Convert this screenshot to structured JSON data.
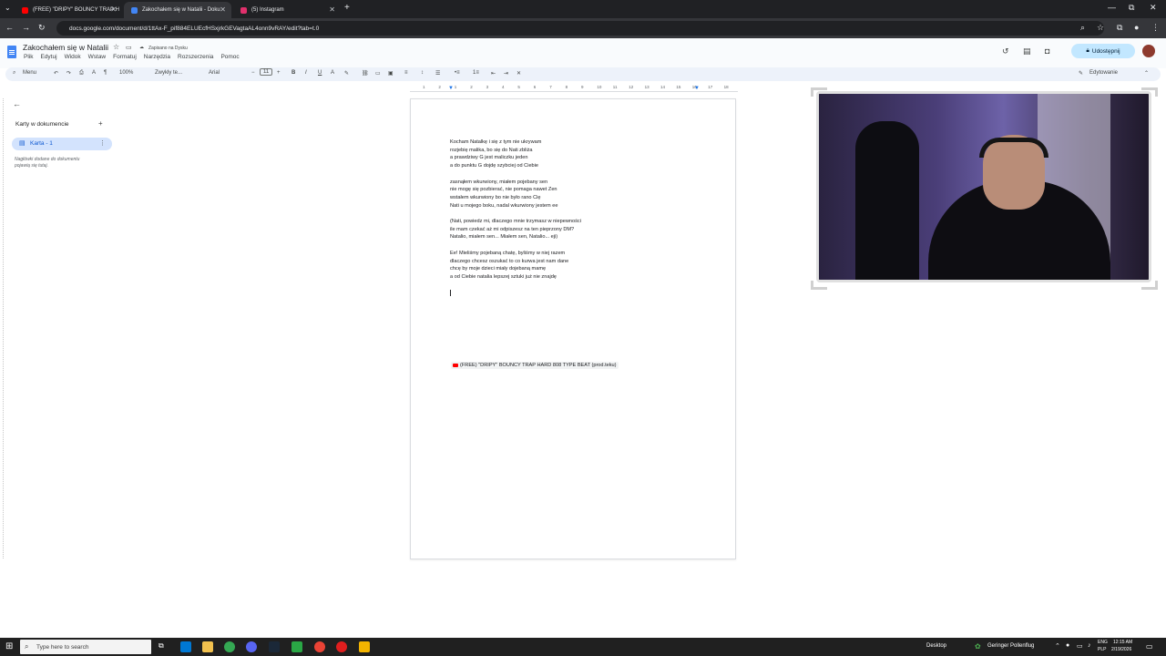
{
  "browser": {
    "tabs": [
      {
        "label": "(FREE) \"DRIPY\" BOUNCY TRAP H",
        "color": "#ff0000",
        "active": false
      },
      {
        "label": "Zakochałem się w Natalii - Doku",
        "color": "#4285f4",
        "active": true
      },
      {
        "label": "(5) Instagram",
        "color": "#e1306c",
        "active": false
      }
    ],
    "url": "docs.google.com/document/d/1ttAx-F_pif884ELUEcfHSxjrkGEVagtaAL4onn9vRAY/edit?tab=t.0",
    "window_controls": [
      "—",
      "⧉",
      "✕"
    ]
  },
  "docs": {
    "title": "Zakochałem się w Natalii",
    "saved_status": "Zapisano na Dysku",
    "menu": [
      "Plik",
      "Edytuj",
      "Widok",
      "Wstaw",
      "Formatuj",
      "Narzędzia",
      "Rozszerzenia",
      "Pomoc"
    ],
    "share_label": "Udostępnij",
    "mode_label": "Edytowanie",
    "toolbar": {
      "menu_label": "Menu",
      "zoom": "100%",
      "style": "Zwykły te...",
      "font": "Arial",
      "font_size": "11"
    },
    "ruler_ticks": [
      "1",
      "2",
      "1",
      "2",
      "3",
      "4",
      "5",
      "6",
      "7",
      "8",
      "9",
      "10",
      "11",
      "12",
      "13",
      "14",
      "15",
      "16",
      "17",
      "18"
    ],
    "sidebar": {
      "title": "Karty w dokumencie",
      "tab_label": "Karta - 1",
      "hint_line1": "Nagłówki dodane do dokumentu",
      "hint_line2": "pojawią się tutaj."
    },
    "lines": [
      "Kocham Natalkę i się z tym nie ukrywam",
      "rozjebię malika, bo się do Nati zbliża",
      "a prawdziwy G jest maliczku jeden",
      "a do punktu G dojdę szybciej od Ciebie",
      "",
      "zasnąłem wkurwiony, miałem pojebany sen",
      "nie mogę się pozbierać, nie pomaga nawet Zen",
      "wstałem wkurwiony bo nie było rano Cię",
      "Nati u mojego boku, nadal wkurwiony jestem ee",
      "",
      "(Nati, powiedz mi, dlaczego mnie trzymasz w niepewności",
      "ile mam czekać aż mi odpiszesz na ten pieprzony DM?",
      "Natalio, miałem sen... Miałem sen, Natalio... eji)",
      "",
      "Ee! Mieliśmy pojebaną chatę, byliśmy w niej razem",
      "dlaczego chcesz oszukać to co kurwa jest nam dane",
      "chcę by moje dzieci miały dojebaną mamę",
      "a od Ciebie natalia lepszej sztuki już nie znajdę"
    ],
    "chip_label": "(FREE) \"DRIPY\" BOUNCY TRAP HARD 808 TYPE BEAT (prod.teku)"
  },
  "taskbar": {
    "search_placeholder": "Type here to search",
    "desktop_label": "Desktop",
    "weather": "Geringer Pollenflug",
    "lang_top": "ENG",
    "lang_bottom": "PLP",
    "time": "12:15 AM",
    "date": "2/19/2026"
  }
}
